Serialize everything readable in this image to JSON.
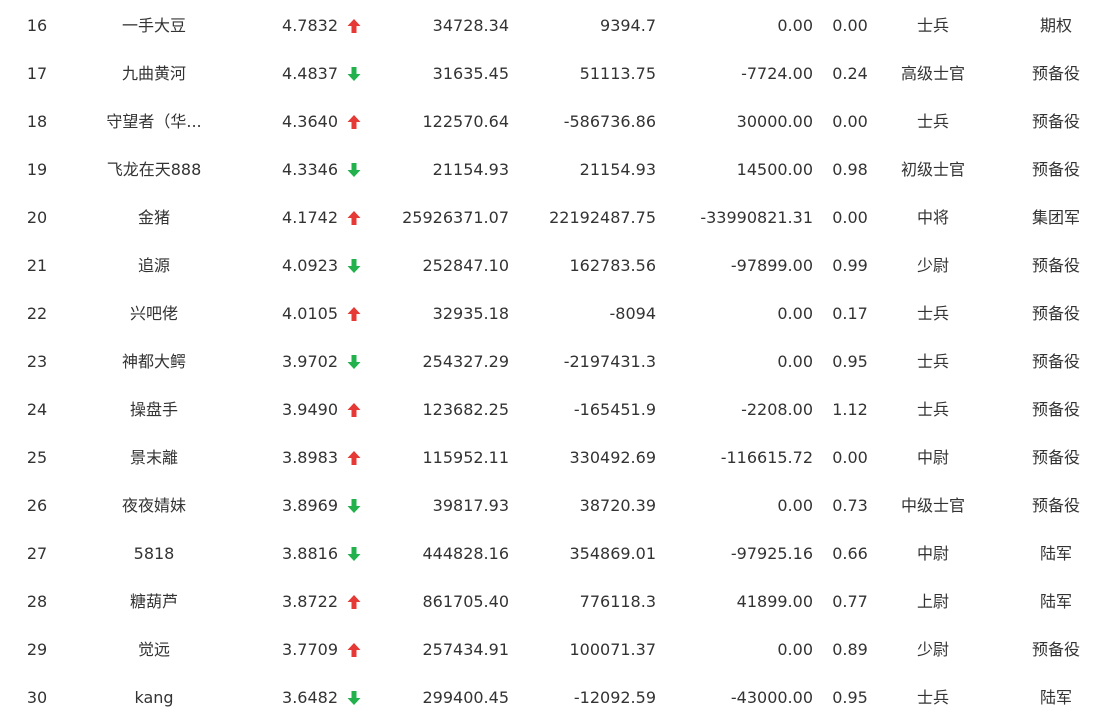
{
  "rows": [
    {
      "rank": "16",
      "name": "一手大豆",
      "score": "4.7832",
      "trend": "up",
      "v1": "34728.34",
      "v2": "9394.7",
      "v3": "0.00",
      "ratio": "0.00",
      "level": "士兵",
      "group": "期权"
    },
    {
      "rank": "17",
      "name": "九曲黄河",
      "score": "4.4837",
      "trend": "down",
      "v1": "31635.45",
      "v2": "51113.75",
      "v3": "-7724.00",
      "ratio": "0.24",
      "level": "高级士官",
      "group": "预备役"
    },
    {
      "rank": "18",
      "name": "守望者（华...",
      "score": "4.3640",
      "trend": "up",
      "v1": "122570.64",
      "v2": "-586736.86",
      "v3": "30000.00",
      "ratio": "0.00",
      "level": "士兵",
      "group": "预备役"
    },
    {
      "rank": "19",
      "name": "飞龙在天888",
      "score": "4.3346",
      "trend": "down",
      "v1": "21154.93",
      "v2": "21154.93",
      "v3": "14500.00",
      "ratio": "0.98",
      "level": "初级士官",
      "group": "预备役"
    },
    {
      "rank": "20",
      "name": "金猪",
      "score": "4.1742",
      "trend": "up",
      "v1": "25926371.07",
      "v2": "22192487.75",
      "v3": "-33990821.31",
      "ratio": "0.00",
      "level": "中将",
      "group": "集团军"
    },
    {
      "rank": "21",
      "name": "追源",
      "score": "4.0923",
      "trend": "down",
      "v1": "252847.10",
      "v2": "162783.56",
      "v3": "-97899.00",
      "ratio": "0.99",
      "level": "少尉",
      "group": "预备役"
    },
    {
      "rank": "22",
      "name": "兴吧佬",
      "score": "4.0105",
      "trend": "up",
      "v1": "32935.18",
      "v2": "-8094",
      "v3": "0.00",
      "ratio": "0.17",
      "level": "士兵",
      "group": "预备役"
    },
    {
      "rank": "23",
      "name": "神都大鳄",
      "score": "3.9702",
      "trend": "down",
      "v1": "254327.29",
      "v2": "-2197431.3",
      "v3": "0.00",
      "ratio": "0.95",
      "level": "士兵",
      "group": "预备役"
    },
    {
      "rank": "24",
      "name": "操盘手",
      "score": "3.9490",
      "trend": "up",
      "v1": "123682.25",
      "v2": "-165451.9",
      "v3": "-2208.00",
      "ratio": "1.12",
      "level": "士兵",
      "group": "预备役"
    },
    {
      "rank": "25",
      "name": "景末離",
      "score": "3.8983",
      "trend": "up",
      "v1": "115952.11",
      "v2": "330492.69",
      "v3": "-116615.72",
      "ratio": "0.00",
      "level": "中尉",
      "group": "预备役"
    },
    {
      "rank": "26",
      "name": "夜夜婧妹",
      "score": "3.8969",
      "trend": "down",
      "v1": "39817.93",
      "v2": "38720.39",
      "v3": "0.00",
      "ratio": "0.73",
      "level": "中级士官",
      "group": "预备役"
    },
    {
      "rank": "27",
      "name": "5818",
      "score": "3.8816",
      "trend": "down",
      "v1": "444828.16",
      "v2": "354869.01",
      "v3": "-97925.16",
      "ratio": "0.66",
      "level": "中尉",
      "group": "陆军"
    },
    {
      "rank": "28",
      "name": "糖葫芦",
      "score": "3.8722",
      "trend": "up",
      "v1": "861705.40",
      "v2": "776118.3",
      "v3": "41899.00",
      "ratio": "0.77",
      "level": "上尉",
      "group": "陆军"
    },
    {
      "rank": "29",
      "name": "觉远",
      "score": "3.7709",
      "trend": "up",
      "v1": "257434.91",
      "v2": "100071.37",
      "v3": "0.00",
      "ratio": "0.89",
      "level": "少尉",
      "group": "预备役"
    },
    {
      "rank": "30",
      "name": "kang",
      "score": "3.6482",
      "trend": "down",
      "v1": "299400.45",
      "v2": "-12092.59",
      "v3": "-43000.00",
      "ratio": "0.95",
      "level": "士兵",
      "group": "陆军"
    }
  ],
  "colors": {
    "up": "#e53935",
    "down": "#22b14c"
  },
  "icons": {
    "up": "arrow-up-icon",
    "down": "arrow-down-icon"
  }
}
